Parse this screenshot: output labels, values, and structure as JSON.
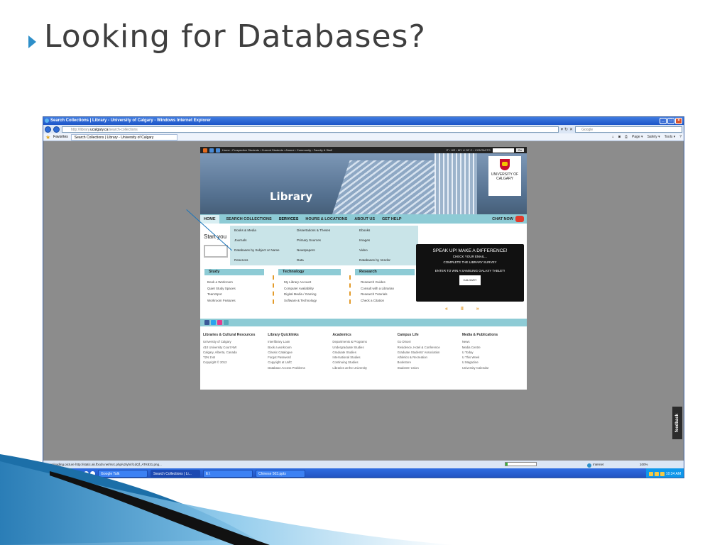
{
  "slide": {
    "title": "Looking for Databases?"
  },
  "ie": {
    "window_title": "Search Collections | Library - University of Calgary - Windows Internet Explorer",
    "url_prefix": "http://library.",
    "url_domain": "ucalgary.ca",
    "url_path": "/search-collections",
    "search_placeholder": "Google",
    "favorites_label": "Favorites",
    "tab_title": "Search Collections | Library - University of Calgary",
    "cmd": {
      "page": "Page ▾",
      "safety": "Safety ▾",
      "tools": "Tools ▾"
    },
    "status_text": "Downloading picture http://static.ak.fbcdn.net/rsrc.php/v2/yh/r/1dQf_ATK831.png...",
    "progress": 0.08,
    "zone": "Internet",
    "zoom": "100%"
  },
  "taskbar": {
    "start": "start",
    "items": [
      "Google Talk",
      "Search Collections | Li...",
      "E:\\",
      "Chinese 503.pptx"
    ],
    "clock": "10:34 AM"
  },
  "site": {
    "topbar_links": "Home › Prospective Students › Current Students › Alumni › Community › Faculty & Staff",
    "topbar_right": "IT › HR › MY U OF C › CONTACTS",
    "go": "Go",
    "banner_title": "Library",
    "crest": {
      "line1": "UNIVERSITY OF",
      "line2": "CALGARY"
    },
    "nav": {
      "home": "HOME",
      "search": "SEARCH COLLECTIONS",
      "services": "SERVICES",
      "hours": "HOURS & LOCATIONS",
      "about": "ABOUT US",
      "help": "GET HELP",
      "chat": "CHAT NOW"
    },
    "dropdown": [
      "Books & Media",
      "Dissertations & Theses",
      "Ebooks",
      "Journals",
      "Primary Sources",
      "Images",
      "Databases by Subject or Name",
      "Newspapers",
      "Video",
      "Reserves",
      "Data",
      "Databases by Vendor"
    ],
    "start_text": "Start you",
    "columns": [
      {
        "heading": "Study",
        "items": [
          "Book a Workroom",
          "Quiet Study Spaces",
          "TeamSpot",
          "Workroom Features"
        ]
      },
      {
        "heading": "Technology",
        "items": [
          "My Library Account",
          "Computer Availability",
          "Digital Media / Gaming",
          "Software & Technology"
        ]
      },
      {
        "heading": "Research",
        "items": [
          "Research Guides",
          "Consult with a Librarian",
          "Research Tutorials",
          "Check a Citation"
        ]
      }
    ],
    "promo": {
      "line1": "SPEAK UP! MAKE A DIFFERENCE!",
      "line2": "CHECK YOUR EMAIL...",
      "line3": "COMPLETE THE LIBRARY SURVEY",
      "line4": "ENTER TO WIN A SAMSUNG GALAXY TABLET!",
      "logo": "CALGARY"
    },
    "pager": {
      "prev": "«",
      "pause": "II",
      "next": "»"
    },
    "footer": [
      {
        "heading": "Libraries & Cultural Resources",
        "items": [
          "University of Calgary",
          "410 University Court NW",
          "Calgary, Alberta, Canada",
          "T2N 1N4",
          "Copyright © 2012"
        ]
      },
      {
        "heading": "Library Quicklinks",
        "items": [
          "Interlibrary Loan",
          "Book a workroom",
          "Classic Catalogue",
          "Forgot Password",
          "Copyright at UofC",
          "Database Access Problems"
        ]
      },
      {
        "heading": "Academics",
        "items": [
          "Departments & Programs",
          "Undergraduate Studies",
          "Graduate Studies",
          "International Studies",
          "Continuing Studies",
          "Libraries at the University"
        ]
      },
      {
        "heading": "Campus Life",
        "items": [
          "Go Dinos!",
          "Residence, Hotel & Conference",
          "Graduate Students' Association",
          "Athletics & Recreation",
          "Bookstore",
          "Students' Union"
        ]
      },
      {
        "heading": "Media & Publications",
        "items": [
          "News",
          "Media Centre",
          "U Today",
          "U This Week",
          "U Magazine",
          "University Calendar"
        ]
      }
    ],
    "feedback": "feedback"
  },
  "colors": {
    "accent_teal": "#8dcbd5",
    "bullet_blue": "#2e8fc9",
    "chat_red": "#e23a2b",
    "divider_orange": "#e39b2b"
  }
}
